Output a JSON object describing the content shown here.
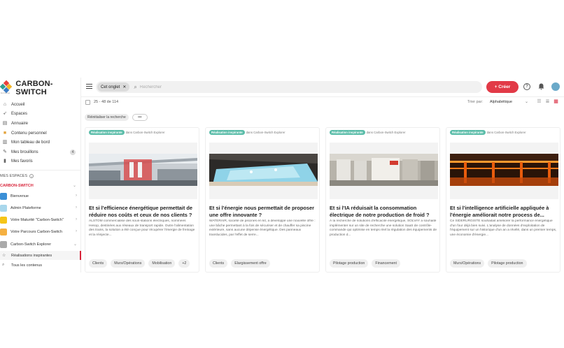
{
  "app": {
    "brand_name": "CARBON-SWITCH",
    "brand_sub": "Exchange",
    "nav": [
      {
        "label": "Accueil",
        "icon": "home-icon"
      },
      {
        "label": "Espaces",
        "icon": "rocket-icon"
      },
      {
        "label": "Annuaire",
        "icon": "contacts-icon"
      },
      {
        "label": "Contenu personnel",
        "icon": "folder-icon"
      },
      {
        "label": "Mon tableau de bord",
        "icon": "dashboard-icon"
      },
      {
        "label": "Mes brouillons",
        "icon": "draft-icon",
        "badge": "4"
      },
      {
        "label": "Mes favoris",
        "icon": "bookmark-icon"
      }
    ],
    "espaces_label": "MES ESPACES",
    "info_icon": "i",
    "carbon_switch_label": "CARBON-SWITCH",
    "spaces": [
      {
        "label": "Bienvenue",
        "color": "#3b8fd6"
      },
      {
        "label": "Admin Plateforme",
        "color": "#a9d7ec"
      },
      {
        "label": "Votre Maturité \"Carbon-Switch\"",
        "color": "#f5c518"
      },
      {
        "label": "Votre Parcours Carbon-Switch",
        "color": "#f5b041"
      },
      {
        "label": "Carbon-Switch Explorer",
        "color": "#aaaaaa"
      }
    ],
    "sub_items": [
      {
        "label": "Réalisations inspirantes",
        "active": true
      },
      {
        "label": "Tous les contenus",
        "active": false
      }
    ]
  },
  "topbar": {
    "tab_chip": "Cet onglet",
    "search_placeholder": "Rechercher",
    "create_label": "+ Créer",
    "help_icon": "?",
    "bell_icon": "bell"
  },
  "toolbar": {
    "count": "25 - 48 de 114",
    "sort_label": "Trier par:",
    "sort_value": "Alphabétique",
    "reset_label": "Réinitialiser la recherche",
    "more_label": "•••"
  },
  "cards": [
    {
      "tag": "Réalisation inspirante",
      "source": "dans Carbon-Switch Explorer",
      "title": "Et si l'efficience énergétique permettait de réduire nos coûts et ceux de nos clients ?",
      "desc": "ALSTOM commercialise des sous-stations électriques, nommées Hesop, destinées aux réseaux de transport rapide. Outre l'alimentation des trains, la solution a été conçue pour récupérer l'énergie de freinage et la réinjecte...",
      "tags": [
        "Clients",
        "Murs/Opérations",
        "Mobilisation",
        "+2"
      ],
      "image": "train-station"
    },
    {
      "tag": "Réalisation inspirante",
      "source": "dans Carbon-Switch Explorer",
      "title": "Et si l'énergie nous permettait de proposer une offre innovante ?",
      "desc": "WATERAIR, société de piscines en kit, a développé une nouvelle offre : une bâche permettant à la fois de sécuriser et de chauffer sa piscine extérieure, sans aucune dépense énergétique. Des panneaux translucides, par l'effet de serre...",
      "tags": [
        "Clients",
        "Elargissement offre"
      ],
      "image": "pool"
    },
    {
      "tag": "Réalisation inspirante",
      "source": "dans Carbon-Switch Explorer",
      "title": "Et si l'IA réduisait la consommation électrique de notre production de froid ?",
      "desc": "À la recherche de solutions d'efficacité énergétique, SOLVAY a souhaité implémenter sur un site de recherche une solution SaaS de contrôle-commande qui optimise en temps réel la régulation des équipements de production d...",
      "tags": [
        "Pilotage production",
        "Financement"
      ],
      "image": "chiller"
    },
    {
      "tag": "Réalisation inspirante",
      "source": "dans Carbon-Switch Explorer",
      "title": "Et si l'intelligence artificielle appliquée à l'énergie améliorait notre process de...",
      "desc": "Ce SIDERURGISTE souhaitait améliorer la performance énergétique d'un four déjà bien suivi. L'analyse de données d'exploitation de l'équipement sur un historique d'un an a révélé, dans un premier temps, une économie d'énergie...",
      "tags": [
        "Murs/Opérations",
        "Pilotage production"
      ],
      "image": "furnace"
    }
  ]
}
